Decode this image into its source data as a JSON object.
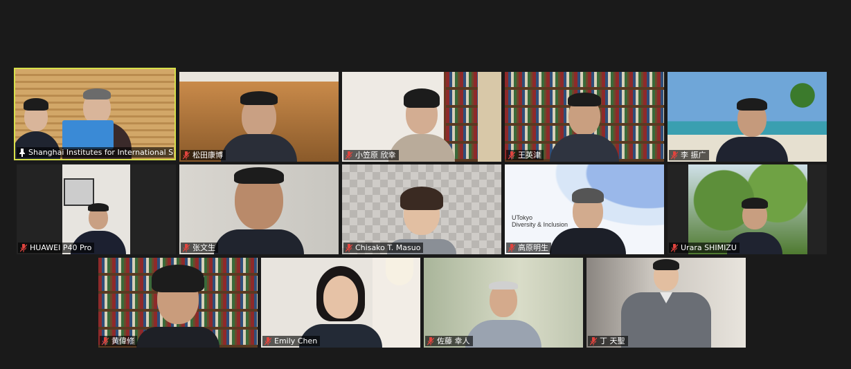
{
  "participants": [
    {
      "name": "Shanghai Institutes for International St...",
      "muted": false,
      "pinned": true,
      "active": true
    },
    {
      "name": "松田康博",
      "muted": true
    },
    {
      "name": "小笠原 欣幸",
      "muted": true
    },
    {
      "name": "王英津",
      "muted": true
    },
    {
      "name": "李 振广",
      "muted": true
    },
    {
      "name": "HUAWEI P40 Pro",
      "muted": true
    },
    {
      "name": "张文生",
      "muted": true
    },
    {
      "name": "Chisako T. Masuo",
      "muted": true
    },
    {
      "name": "高原明生",
      "muted": true
    },
    {
      "name": "Urara SHIMIZU",
      "muted": true
    },
    {
      "name": "黄偉修",
      "muted": true
    },
    {
      "name": "Emily Chen",
      "muted": true
    },
    {
      "name": "佐藤 幸人",
      "muted": true
    },
    {
      "name": "丁 天聖",
      "muted": true
    }
  ],
  "backgrounds": {
    "utokyo_logo": "UTokyo",
    "utokyo_tagline": "Diversity & Inclusion"
  },
  "colors": {
    "active_speaker_border": "#d7e04a",
    "muted_icon": "#e0443e",
    "window_bg": "#1a1a1a"
  },
  "icons": {
    "muted": "mic-muted-icon",
    "pinned": "pin-icon"
  }
}
